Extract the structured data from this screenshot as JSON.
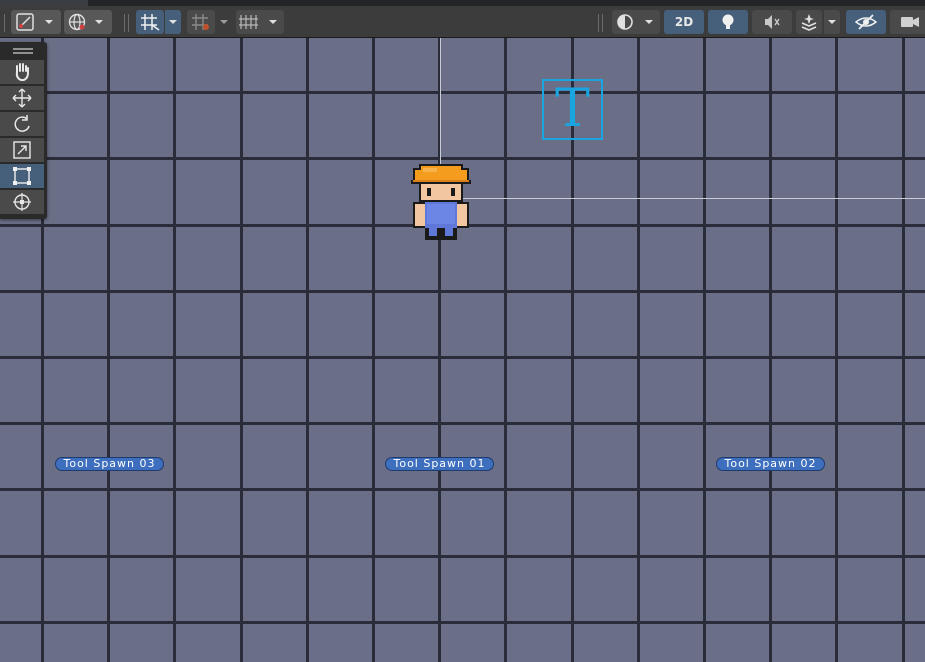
{
  "toolbar": {
    "mode_2d_label": "2D",
    "buttons": [
      {
        "name": "draw-mode-icon",
        "active": false
      },
      {
        "name": "global-local-icon",
        "active": false
      },
      {
        "name": "grid-snap-icon",
        "active": true
      },
      {
        "name": "grid-visibility-icon",
        "active": false
      },
      {
        "name": "increment-snap-icon",
        "active": false
      },
      {
        "name": "shading-icon",
        "active": false
      },
      {
        "name": "2d-toggle",
        "active": true
      },
      {
        "name": "lighting-icon",
        "active": true
      },
      {
        "name": "audio-icon",
        "active": false
      },
      {
        "name": "effects-icon",
        "active": false
      },
      {
        "name": "hidden-objects-icon",
        "active": true
      },
      {
        "name": "camera-icon",
        "active": false
      }
    ]
  },
  "tools": [
    {
      "name": "hand-tool",
      "icon": "hand-icon",
      "active": false
    },
    {
      "name": "move-tool",
      "icon": "move-icon",
      "active": false
    },
    {
      "name": "rotate-tool",
      "icon": "rotate-icon",
      "active": false
    },
    {
      "name": "scale-tool",
      "icon": "scale-icon",
      "active": false
    },
    {
      "name": "rect-tool",
      "icon": "rect-transform-icon",
      "active": true
    },
    {
      "name": "transform-tool",
      "icon": "transform-icon",
      "active": false
    }
  ],
  "scene": {
    "text_gizmo_letter": "T",
    "spawn_labels": {
      "spawn_03": "Tool Spawn 03",
      "spawn_01": "Tool Spawn 01",
      "spawn_02": "Tool Spawn 02"
    },
    "colors": {
      "tile": "#6a6e86",
      "grid_line": "#2a2c3a",
      "label_bg": "#3e6fbe",
      "text_gizmo": "#19a6e0"
    }
  }
}
